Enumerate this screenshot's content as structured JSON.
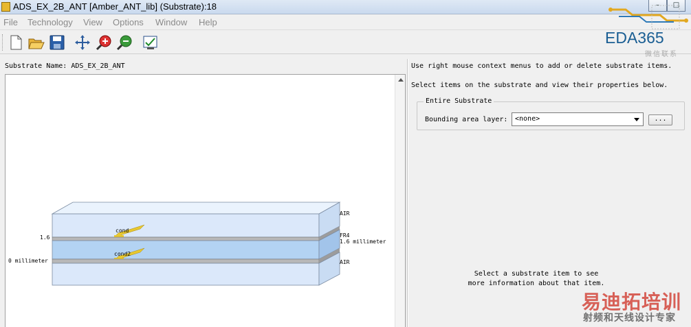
{
  "window": {
    "title": "ADS_EX_2B_ANT [Amber_ANT_lib] (Substrate):18"
  },
  "menu": [
    "File",
    "Technology",
    "View",
    "Options",
    "Window",
    "Help"
  ],
  "toolbar": [
    "new-icon",
    "open-icon",
    "save-icon",
    "pan-icon",
    "zoom-in-icon",
    "zoom-out-icon",
    "check-icon"
  ],
  "logo": {
    "text": "EDA365",
    "sub": "微信联系"
  },
  "left": {
    "substrate_name_label": "Substrate Name:",
    "substrate_name": "ADS_EX_2B_ANT"
  },
  "diagram": {
    "left_labels": [
      "1.6",
      "0 millimeter"
    ],
    "right_labels": [
      "AIR",
      "FR4",
      "1.6 millimeter",
      "AIR"
    ],
    "conductors": [
      "cond",
      "cond2"
    ]
  },
  "right": {
    "hint1": "Use right mouse context menus to add or delete substrate items.",
    "hint2": "Select items on the substrate and view their properties below.",
    "group_title": "Entire Substrate",
    "bounding_label": "Bounding area layer:",
    "bounding_value": "<none>",
    "browse_button": "...",
    "info_line1": "Select a substrate item to see",
    "info_line2": "more information about that item."
  },
  "watermark": {
    "line1": "易迪拓培训",
    "line2": "射频和天线设计专家"
  },
  "colors": {
    "accent": "#1a5e93",
    "layer_fill": "#d6e6fa",
    "fr4_fill": "#b4d4f4",
    "conductor": "#e8c830"
  }
}
